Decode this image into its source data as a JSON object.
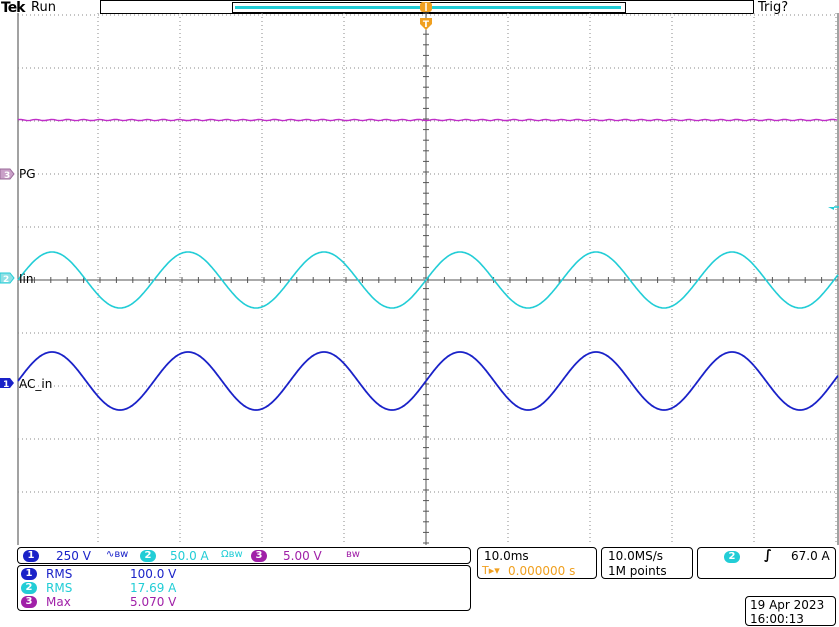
{
  "header": {
    "brand": "Tek",
    "status": "Run",
    "trigger_status": "Trig?",
    "trigger_marker": "T"
  },
  "channels": {
    "ch1": {
      "number": "1",
      "label": "AC_in",
      "scale": "250 V",
      "color": "#1a22c8"
    },
    "ch2": {
      "number": "2",
      "label": "Iin",
      "scale": "50.0 A",
      "color": "#22cdd6"
    },
    "ch3": {
      "number": "3",
      "label": "PG",
      "scale": "5.00 V",
      "color": "#c02ec8"
    }
  },
  "coupling": {
    "ch1": "∿ʙw",
    "ch2": "Ωʙw",
    "ch3": "ʙw"
  },
  "measurements": [
    {
      "ch": "1",
      "name": "RMS",
      "value": "100.0 V",
      "color": "#1a22c8"
    },
    {
      "ch": "2",
      "name": "RMS",
      "value": "17.69 A",
      "color": "#22cdd6"
    },
    {
      "ch": "3",
      "name": "Max",
      "value": "5.070 V",
      "color": "#a020a8"
    }
  ],
  "timebase": {
    "scale": "10.0ms",
    "delay_symbol": "T▸▾",
    "delay": "0.000000 s"
  },
  "acquisition": {
    "rate": "10.0MS/s",
    "record": "1M points"
  },
  "trigger": {
    "source": "2",
    "slope": "∫",
    "level": "67.0 A"
  },
  "datetime": {
    "date": "19 Apr  2023",
    "time": "16:00:13"
  },
  "colors": {
    "ch1": "#1a22c8",
    "ch2": "#22cdd6",
    "ch3": "#c02ec8",
    "trigger": "#f0a020"
  }
}
